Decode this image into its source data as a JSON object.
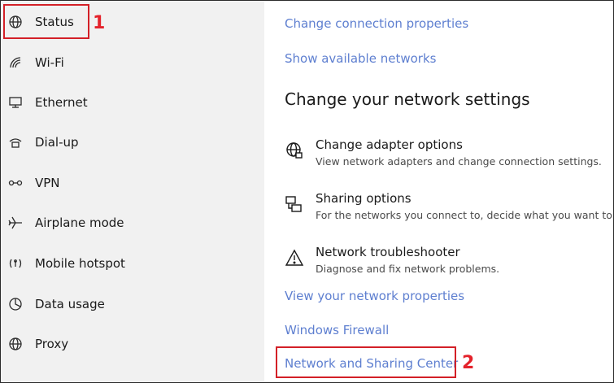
{
  "sidebar": {
    "items": [
      {
        "label": "Status",
        "icon": "globe-icon"
      },
      {
        "label": "Wi-Fi",
        "icon": "wifi-icon"
      },
      {
        "label": "Ethernet",
        "icon": "ethernet-icon"
      },
      {
        "label": "Dial-up",
        "icon": "dialup-icon"
      },
      {
        "label": "VPN",
        "icon": "vpn-icon"
      },
      {
        "label": "Airplane mode",
        "icon": "airplane-icon"
      },
      {
        "label": "Mobile hotspot",
        "icon": "hotspot-icon"
      },
      {
        "label": "Data usage",
        "icon": "data-usage-icon"
      },
      {
        "label": "Proxy",
        "icon": "globe-icon"
      }
    ]
  },
  "main": {
    "links_top": [
      "Change connection properties",
      "Show available networks"
    ],
    "section_title": "Change your network settings",
    "options": [
      {
        "title": "Change adapter options",
        "desc": "View network adapters and change connection settings.",
        "icon": "adapter-globe-icon"
      },
      {
        "title": "Sharing options",
        "desc": "For the networks you connect to, decide what you want to sha",
        "icon": "sharing-icon"
      },
      {
        "title": "Network troubleshooter",
        "desc": "Diagnose and fix network problems.",
        "icon": "warning-triangle-icon"
      }
    ],
    "links_bottom": [
      "View your network properties",
      "Windows Firewall",
      "Network and Sharing Center"
    ]
  },
  "annotations": {
    "step1": "1",
    "step2": "2"
  },
  "colors": {
    "highlight": "#d32027",
    "link": "#5e7fd0",
    "sidebar_bg": "#f1f1f1"
  }
}
